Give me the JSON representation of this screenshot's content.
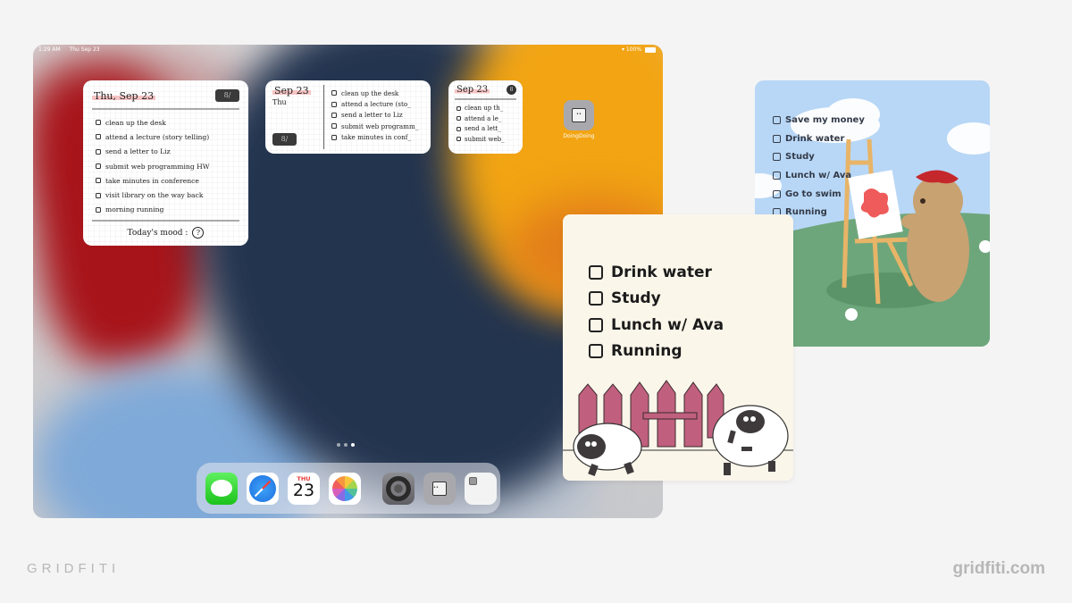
{
  "status_bar": {
    "time": "1:29 AM",
    "date": "Thu Sep 23",
    "wifi_icon": "wifi-icon",
    "battery": "100%"
  },
  "widget_large": {
    "date": "Thu, Sep 23",
    "badge": "8/",
    "tasks": [
      "clean up the desk",
      "attend a lecture (story telling)",
      "send a letter to Liz",
      "submit web programming HW",
      "take minutes in conference",
      "visit library on the way back",
      "morning running"
    ],
    "mood_label": "Today's mood :",
    "mood_icon": "?"
  },
  "widget_medium": {
    "date": "Sep 23",
    "day": "Thu",
    "badge": "8/",
    "tasks": [
      "clean up the desk",
      "attend a lecture (sto_",
      "send a letter to Liz",
      "submit web programm_",
      "take minutes in conf_"
    ]
  },
  "widget_small": {
    "date": "Sep 23",
    "badge": "8",
    "tasks": [
      "clean up th_",
      "attend a le_",
      "send a lett_",
      "submit web_"
    ]
  },
  "home_app": {
    "label": "DoingDoing",
    "icon": "doingdoing-app-icon"
  },
  "page_indicator": {
    "pages": 3,
    "current": 3
  },
  "dock": {
    "apps": [
      {
        "name": "Messages",
        "icon": "messages-icon"
      },
      {
        "name": "Safari",
        "icon": "safari-icon"
      },
      {
        "name": "Calendar",
        "icon": "calendar-icon",
        "day": "THU",
        "date": "23"
      },
      {
        "name": "Photos",
        "icon": "photos-icon"
      },
      {
        "name": "Settings",
        "icon": "settings-icon"
      },
      {
        "name": "DoingDoing",
        "icon": "doingdoing-icon"
      },
      {
        "name": "App Library",
        "icon": "folder-icon"
      }
    ]
  },
  "card_sheep": {
    "tasks": [
      "Drink water",
      "Study",
      "Lunch w/ Ava",
      "Running"
    ],
    "colors": {
      "background": "#fbf6ea",
      "fence": "#c0607e"
    }
  },
  "card_bear": {
    "tasks": [
      "Save my money",
      "Drink water",
      "Study",
      "Lunch w/ Ava",
      "Go to swim",
      "Running"
    ],
    "colors": {
      "sky": "#b8d7f6",
      "grass": "#6ea67c",
      "bear": "#c9a271",
      "beret": "#c5282c",
      "paint": "#ef5a5a"
    }
  },
  "branding": {
    "left": "GRIDFITI",
    "right": "gridfiti.com"
  }
}
